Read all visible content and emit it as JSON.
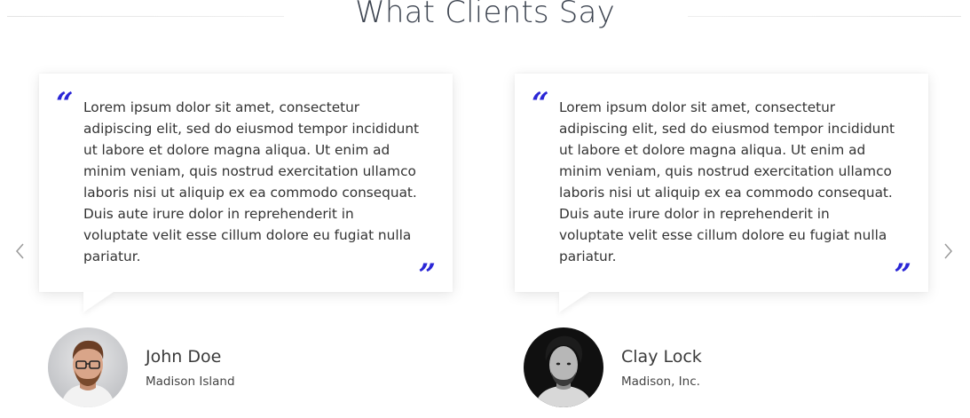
{
  "section": {
    "title": "What Clients Say"
  },
  "testimonials": [
    {
      "text": "Lorem ipsum dolor sit amet, consectetur adipiscing elit, sed do eiusmod tempor incididunt ut labore et dolore magna aliqua. Ut enim ad minim veniam, quis nostrud exercitation ullamco laboris nisi ut aliquip ex ea commodo consequat. Duis aute irure dolor in reprehenderit in voluptate velit esse cillum dolore eu fugiat nulla pariatur.",
      "name": "John Doe",
      "company": "Madison Island"
    },
    {
      "text": "Lorem ipsum dolor sit amet, consectetur adipiscing elit, sed do eiusmod tempor incididunt ut labore et dolore magna aliqua. Ut enim ad minim veniam, quis nostrud exercitation ullamco laboris nisi ut aliquip ex ea commodo consequat. Duis aute irure dolor in reprehenderit in voluptate velit esse cillum dolore eu fugiat nulla pariatur.",
      "name": "Clay Lock",
      "company": "Madison, Inc."
    }
  ],
  "quotes": {
    "open": "“",
    "close": "”"
  },
  "icons": {
    "prev": "chevron-left-icon",
    "next": "chevron-right-icon",
    "quote": "quote-icon"
  },
  "colors": {
    "accent": "#2a26d6",
    "title": "#3d4450",
    "text": "#333333"
  }
}
